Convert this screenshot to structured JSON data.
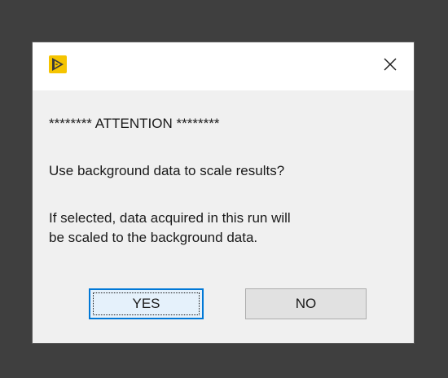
{
  "dialog": {
    "close_symbol": "×",
    "heading": "******** ATTENTION ********",
    "question": "Use background data to scale results?",
    "info_line1": "If selected, data acquired in this run will",
    "info_line2": "be scaled to the background data.",
    "yes_label": "YES",
    "no_label": "NO"
  },
  "colors": {
    "app_icon": "#f5c400",
    "desktop_background": "#3f3f3f",
    "dialog_background": "#f0f0f0",
    "default_button_border": "#0078d7"
  },
  "icons": {
    "app": "labview-app-icon",
    "close": "close-icon"
  }
}
